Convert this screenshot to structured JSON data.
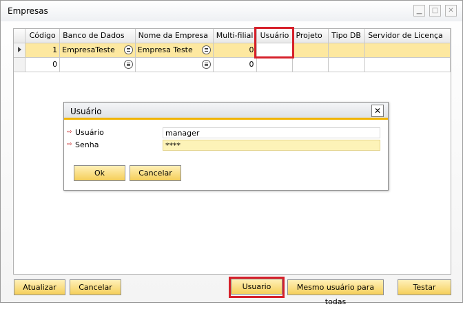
{
  "window": {
    "title": "Empresas",
    "controls": {
      "minimize": "▁",
      "maximize": "□",
      "close": "✕"
    }
  },
  "grid": {
    "columns": [
      "Código",
      "Banco de Dados",
      "Nome da Empresa",
      "Multi-filial",
      "Usuário",
      "Projeto",
      "Tipo DB",
      "Servidor de Licença"
    ],
    "rows": [
      {
        "codigo": "1",
        "banco": "EmpresaTeste",
        "nome": "Empresa Teste",
        "multifilial": "0",
        "usuario": "",
        "projeto": "",
        "tipodb": "",
        "servidor": ""
      },
      {
        "codigo": "0",
        "banco": "",
        "nome": "",
        "multifilial": "0",
        "usuario": "",
        "projeto": "",
        "tipodb": "",
        "servidor": ""
      }
    ]
  },
  "dialog": {
    "title": "Usuário",
    "close": "✕",
    "fields": [
      {
        "label": "Usuário",
        "value": "manager"
      },
      {
        "label": "Senha",
        "value": "****"
      }
    ],
    "ok_label": "Ok",
    "cancel_label": "Cancelar"
  },
  "footer": {
    "atualizar_label": "Atualizar",
    "cancelar_label": "Cancelar",
    "usuario_label": "Usuario",
    "mesmo_usuario_label": "Mesmo usuário para todas",
    "testar_label": "Testar"
  },
  "colors": {
    "selected_row": "#fde8a0",
    "button_gradient_top": "#fff0b8",
    "button_gradient_bottom": "#f5cf5a",
    "highlight_red": "#d6202a",
    "dialog_accent": "#f0b400"
  }
}
